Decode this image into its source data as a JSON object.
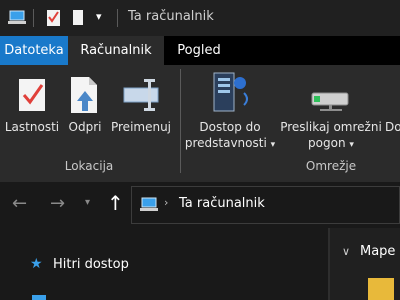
{
  "window": {
    "title": "Ta računalnik"
  },
  "tabs": [
    "Datoteka",
    "Računalnik",
    "Pogled"
  ],
  "ribbon": {
    "location_group": {
      "label": "Lokacija",
      "buttons": {
        "properties": "Lastnosti",
        "open": "Odpri",
        "rename": "Preimenuj"
      }
    },
    "network_group": {
      "label": "Omrežje",
      "media_access_line1": "Dostop do",
      "media_access_line2": "predstavnosti",
      "map_drive_line1": "Preslikaj omrežni",
      "map_drive_line2": "pogon",
      "add_location_partial": "Do"
    }
  },
  "address_bar": {
    "path": "Ta računalnik"
  },
  "nav_pane": {
    "quick_access": "Hitri dostop"
  },
  "main": {
    "section_header_partial": "Mape"
  },
  "colors": {
    "accent": "#1979ca",
    "background": "#191919",
    "ribbon": "#2b2b2b",
    "tabbar": "#000000"
  }
}
